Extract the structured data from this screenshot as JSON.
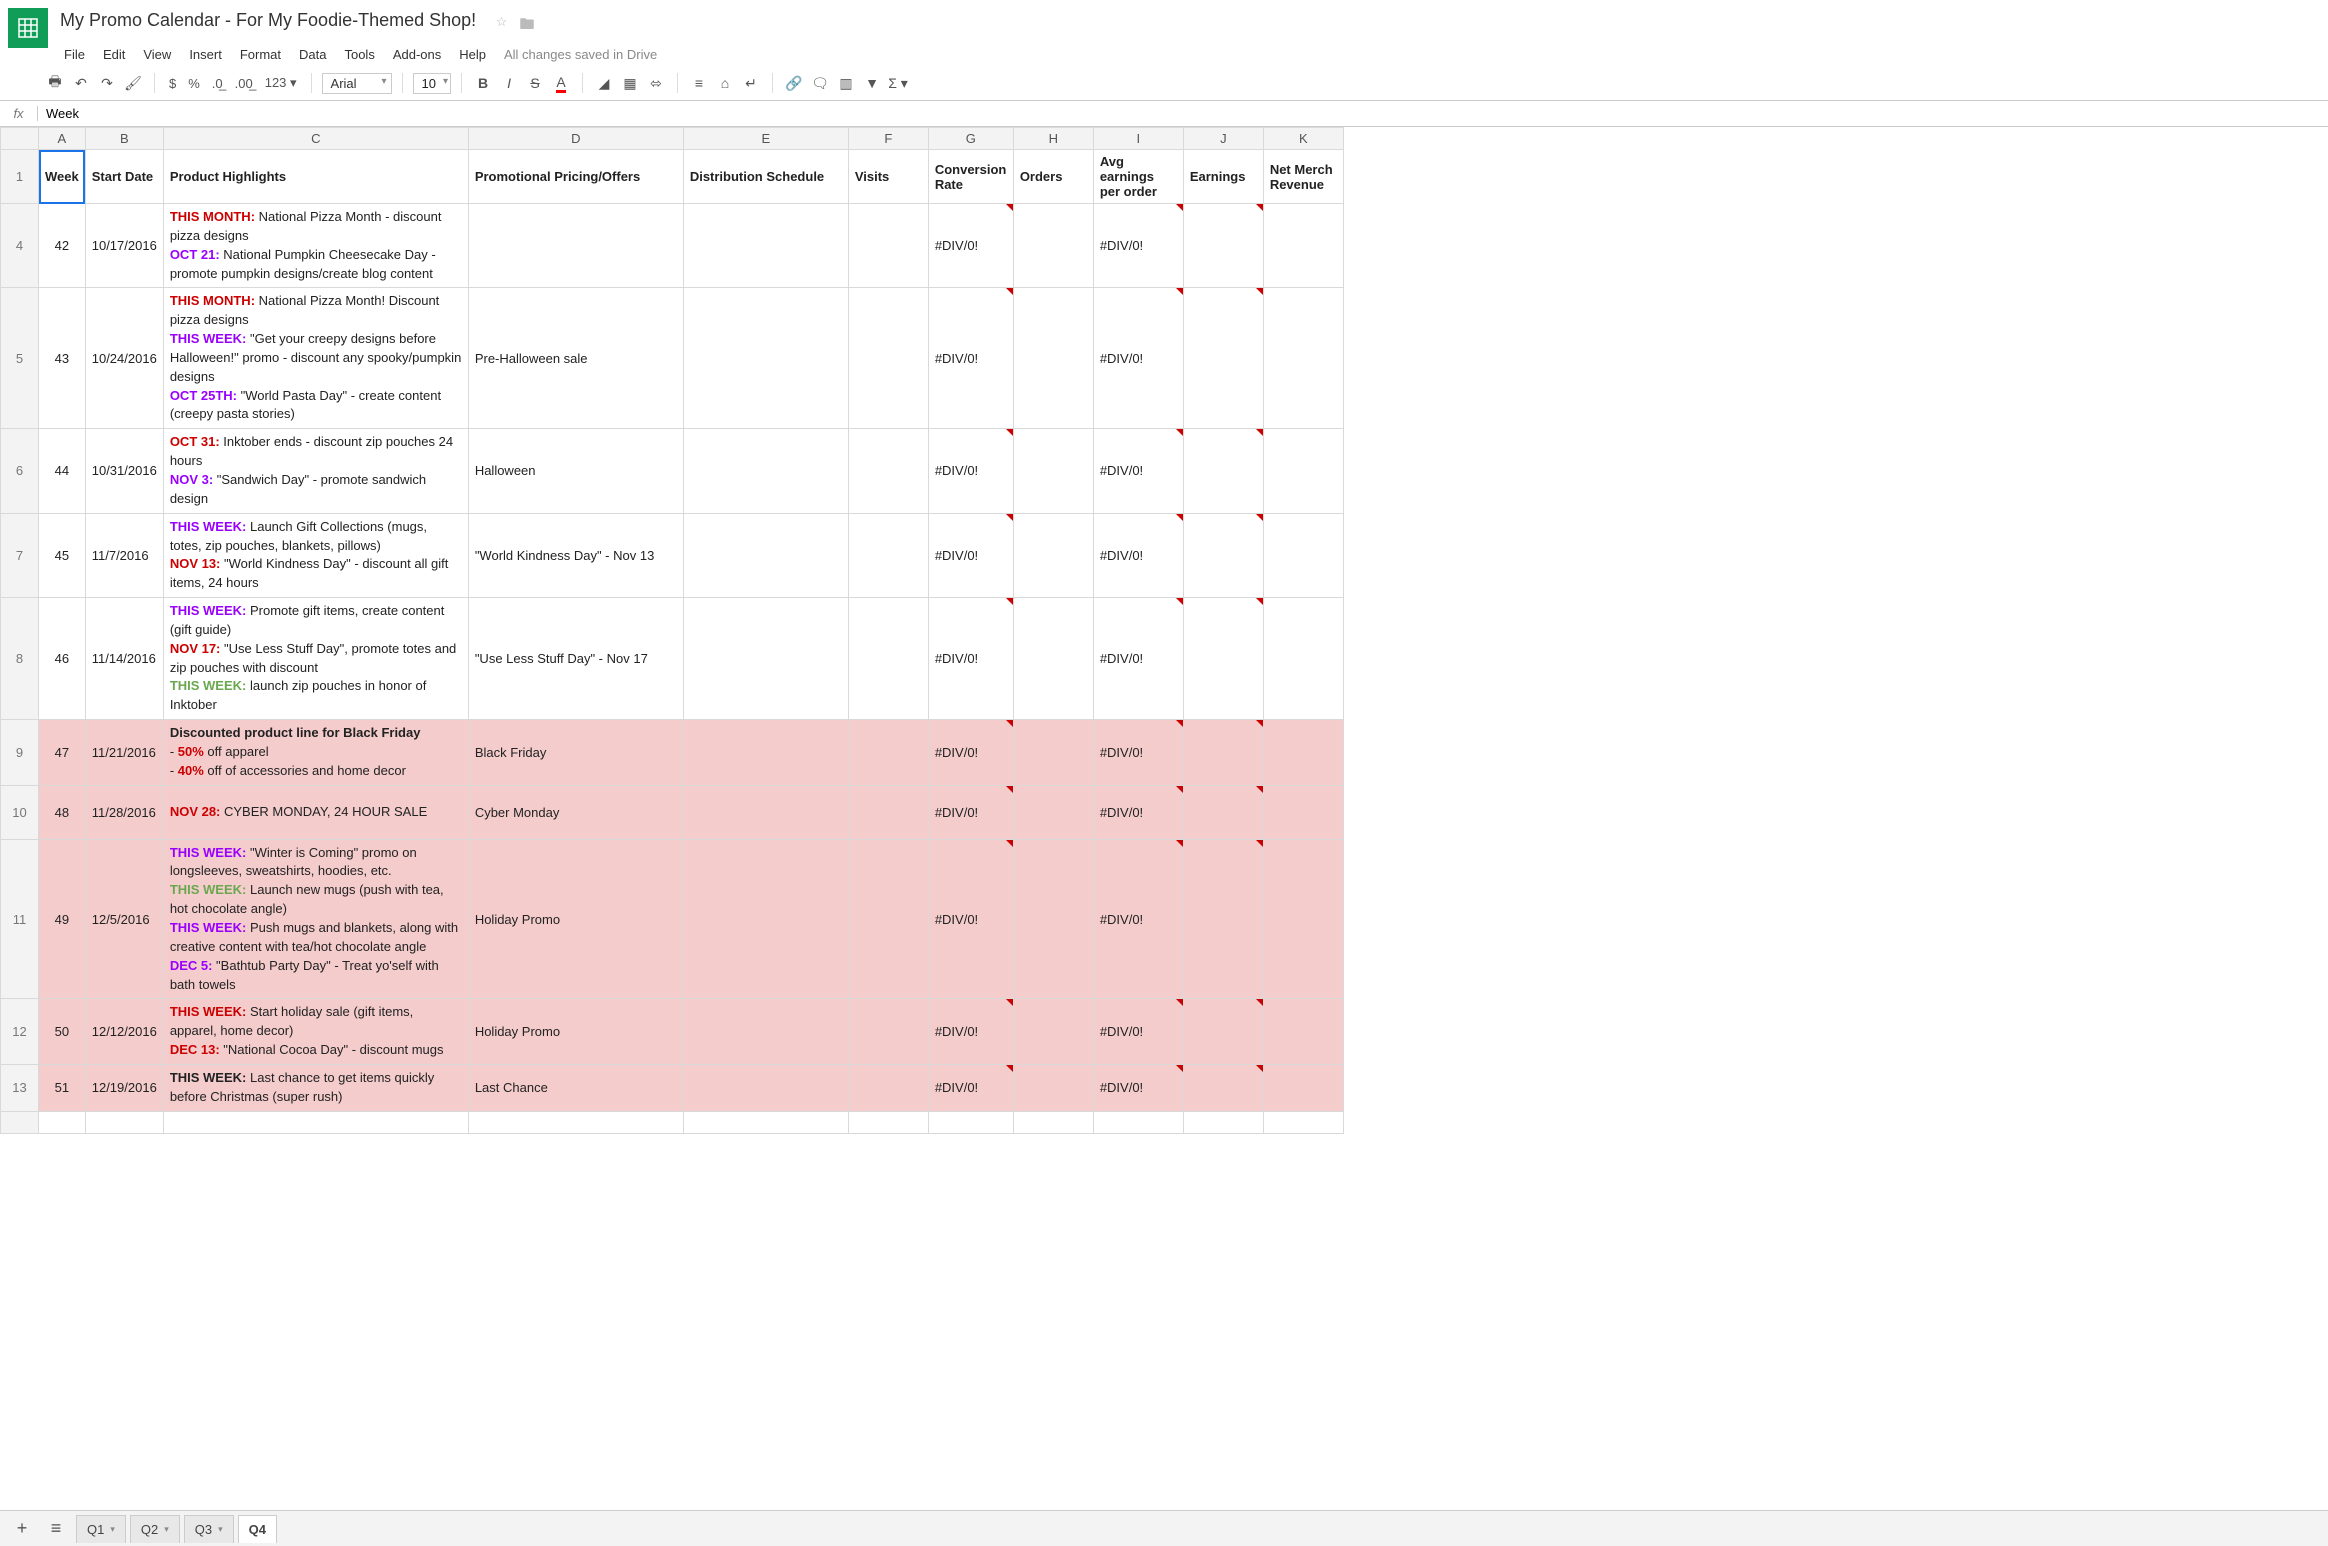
{
  "title": "My Promo Calendar - For My Foodie-Themed Shop!",
  "saved_msg": "All changes saved in Drive",
  "menu": [
    "File",
    "Edit",
    "View",
    "Insert",
    "Format",
    "Data",
    "Tools",
    "Add-ons",
    "Help"
  ],
  "font": "Arial",
  "fontsize": "10",
  "fx_value": "Week",
  "cols": {
    "A": 42,
    "B": 70,
    "C": 305,
    "D": 215,
    "E": 165,
    "F": 80,
    "G": 85,
    "H": 80,
    "I": 90,
    "J": 80,
    "K": 80
  },
  "headers": {
    "week": "Week",
    "start": "Start Date",
    "product": "Product Highlights",
    "pricing": "Promotional Pricing/Offers",
    "dist": "Distribution Schedule",
    "visits": "Visits",
    "conv": "Conversion Rate",
    "orders": "Orders",
    "avg": "Avg earnings per order",
    "earn": "Earnings",
    "net": "Net Merch Revenue"
  },
  "div0": "#DIV/0!",
  "rows": [
    {
      "num": "4",
      "week": "42",
      "date": "10/17/2016",
      "pink": false,
      "product": [
        {
          "style": "s-red",
          "t": "THIS MONTH:"
        },
        {
          "t": " National Pizza Month - discount pizza designs"
        },
        {
          "br": true
        },
        {
          "style": "s-purple",
          "t": "OCT 21:"
        },
        {
          "t": " National Pumpkin Cheesecake Day - promote pumpkin designs/create blog content"
        }
      ],
      "pricing": ""
    },
    {
      "num": "5",
      "week": "43",
      "date": "10/24/2016",
      "pink": false,
      "product": [
        {
          "style": "s-red",
          "t": "THIS MONTH:"
        },
        {
          "t": " National Pizza Month! Discount pizza designs"
        },
        {
          "br": true
        },
        {
          "style": "s-purple",
          "t": "THIS WEEK:"
        },
        {
          "t": " \"Get your creepy designs before Halloween!\" promo - discount any spooky/pumpkin designs"
        },
        {
          "br": true
        },
        {
          "style": "s-purple",
          "t": "OCT 25TH:"
        },
        {
          "t": " \"World Pasta Day\" - create content (creepy pasta stories)"
        }
      ],
      "pricing": "Pre-Halloween sale"
    },
    {
      "num": "6",
      "week": "44",
      "date": "10/31/2016",
      "pink": false,
      "product": [
        {
          "style": "s-red",
          "t": "OCT 31:"
        },
        {
          "t": " Inktober ends - discount zip pouches 24 hours"
        },
        {
          "br": true
        },
        {
          "style": "s-purple",
          "t": "NOV 3:"
        },
        {
          "t": " \"Sandwich Day\" - promote sandwich design"
        }
      ],
      "pricing": "Halloween"
    },
    {
      "num": "7",
      "week": "45",
      "date": "11/7/2016",
      "pink": false,
      "product": [
        {
          "style": "s-purple",
          "t": "THIS WEEK:"
        },
        {
          "t": " Launch Gift Collections (mugs, totes, zip pouches, blankets, pillows)"
        },
        {
          "br": true
        },
        {
          "style": "s-red",
          "t": "NOV 13:"
        },
        {
          "t": " \"World Kindness Day\" - discount all gift items, 24 hours"
        }
      ],
      "pricing": "\"World Kindness Day\" - Nov 13"
    },
    {
      "num": "8",
      "week": "46",
      "date": "11/14/2016",
      "pink": false,
      "product": [
        {
          "style": "s-purple",
          "t": "THIS WEEK:"
        },
        {
          "t": " Promote gift items, create content (gift guide)"
        },
        {
          "br": true
        },
        {
          "style": "s-red",
          "t": "NOV 17:"
        },
        {
          "t": " \"Use Less Stuff Day\", promote totes and zip pouches with discount"
        },
        {
          "br": true
        },
        {
          "style": "s-green",
          "t": "THIS WEEK:"
        },
        {
          "t": " launch zip pouches in honor of Inktober"
        }
      ],
      "pricing": "\"Use Less Stuff Day\" - Nov 17"
    },
    {
      "num": "9",
      "week": "47",
      "date": "11/21/2016",
      "pink": true,
      "product": [
        {
          "style": "s-bold",
          "t": "Discounted product line for Black Friday"
        },
        {
          "br": true
        },
        {
          "t": "- "
        },
        {
          "style": "s-red",
          "t": "50%"
        },
        {
          "t": " off apparel"
        },
        {
          "br": true
        },
        {
          "t": "- "
        },
        {
          "style": "s-red",
          "t": "40%"
        },
        {
          "t": " off of accessories and home decor"
        }
      ],
      "pricing": "Black Friday"
    },
    {
      "num": "10",
      "week": "48",
      "date": "11/28/2016",
      "pink": true,
      "tall": true,
      "product": [
        {
          "style": "s-red",
          "t": "NOV 28:"
        },
        {
          "t": " CYBER MONDAY, 24 HOUR SALE"
        }
      ],
      "pricing": "Cyber Monday"
    },
    {
      "num": "11",
      "week": "49",
      "date": "12/5/2016",
      "pink": true,
      "product": [
        {
          "style": "s-purple",
          "t": "THIS WEEK:"
        },
        {
          "t": " \"Winter is Coming\" promo on longsleeves, sweatshirts, hoodies, etc."
        },
        {
          "br": true
        },
        {
          "style": "s-green",
          "t": "THIS WEEK:"
        },
        {
          "t": " Launch new mugs (push with tea, hot chocolate angle)"
        },
        {
          "br": true
        },
        {
          "style": "s-purple",
          "t": "THIS WEEK:"
        },
        {
          "t": " Push mugs and blankets, along with creative content with tea/hot chocolate angle"
        },
        {
          "br": true
        },
        {
          "style": "s-purple",
          "t": "DEC 5:"
        },
        {
          "t": " \"Bathtub Party Day\" - Treat yo'self with bath towels"
        }
      ],
      "pricing": "Holiday Promo"
    },
    {
      "num": "12",
      "week": "50",
      "date": "12/12/2016",
      "pink": true,
      "product": [
        {
          "style": "s-red",
          "t": "THIS WEEK:"
        },
        {
          "t": " Start holiday sale (gift items, apparel, home decor)"
        },
        {
          "br": true
        },
        {
          "style": "s-red",
          "t": "DEC 13:"
        },
        {
          "t": " \"National Cocoa Day\" - discount mugs"
        }
      ],
      "pricing": "Holiday Promo"
    },
    {
      "num": "13",
      "week": "51",
      "date": "12/19/2016",
      "pink": true,
      "product": [
        {
          "style": "s-bold",
          "t": "THIS WEEK:"
        },
        {
          "t": " Last chance to get items quickly before Christmas (super rush)"
        }
      ],
      "pricing": "Last Chance"
    }
  ],
  "tabs": [
    "Q1",
    "Q2",
    "Q3",
    "Q4"
  ],
  "active_tab": "Q4"
}
